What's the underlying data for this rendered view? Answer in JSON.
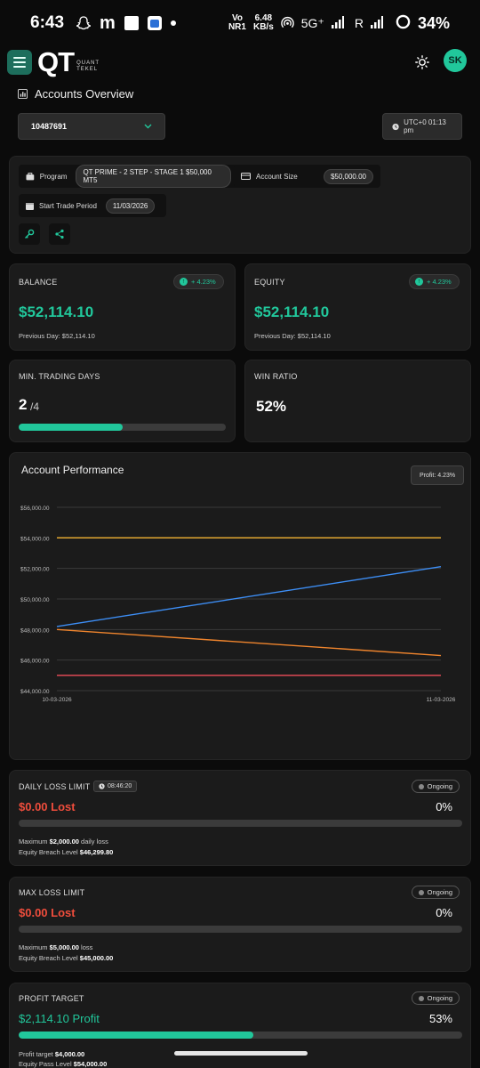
{
  "status_bar": {
    "time": "6:43",
    "net_top": "Vo",
    "net_bottom": "NR1",
    "speed_top": "6.48",
    "speed_bottom": "KB/s",
    "signal": "5G⁺",
    "r_label": "R",
    "battery": "34%"
  },
  "header": {
    "logo_main": "QT",
    "logo_sub_1": "QUANT",
    "logo_sub_2": "TEKEL",
    "avatar": "SK"
  },
  "page": {
    "title": "Accounts Overview"
  },
  "account": {
    "selected": "10487691",
    "utc": "UTC+0 01:13 pm"
  },
  "program": {
    "program_label": "Program",
    "program_value": "QT PRIME - 2 STEP - STAGE 1 $50,000 MT5",
    "size_label": "Account Size",
    "size_value": "$50,000.00",
    "start_label": "Start Trade Period",
    "start_value": "11/03/2026"
  },
  "balance": {
    "label": "BALANCE",
    "change": "+ 4.23%",
    "value": "$52,114.10",
    "previous": "Previous Day: $52,114.10"
  },
  "equity": {
    "label": "EQUITY",
    "change": "+ 4.23%",
    "value": "$52,114.10",
    "previous": "Previous Day: $52,114.10"
  },
  "min_days": {
    "label": "MIN. TRADING DAYS",
    "current": "2",
    "total": "/4",
    "progress": 0.5
  },
  "win_ratio": {
    "label": "WIN RATIO",
    "value": "52%"
  },
  "performance": {
    "title": "Account Performance",
    "profit_badge": "Profit: 4.23%"
  },
  "chart_data": {
    "type": "line",
    "x": [
      "10-03-2026",
      "11-03-2026"
    ],
    "yticks": [
      "$56,000.00",
      "$54,000.00",
      "$52,000.00",
      "$50,000.00",
      "$48,000.00",
      "$46,000.00",
      "$44,000.00"
    ],
    "ylim": [
      44000,
      56000
    ],
    "grid": true,
    "series": [
      {
        "color": "#f2b233",
        "values": [
          54000,
          54000
        ]
      },
      {
        "color": "#3d8ef5",
        "values": [
          48200,
          52114.1
        ]
      },
      {
        "color": "#f0852d",
        "values": [
          48000,
          46300
        ]
      },
      {
        "color": "#ef4d5a",
        "values": [
          45000,
          45000
        ]
      }
    ]
  },
  "daily_loss": {
    "label": "DAILY LOSS LIMIT",
    "timer": "08:46:20",
    "status": "Ongoing",
    "value": "$0.00 Lost",
    "pct": "0%",
    "progress": 0,
    "max_prefix": "Maximum ",
    "max_value": "$2,000.00",
    "max_suffix": " daily loss",
    "breach_label": "Equity Breach Level ",
    "breach_value": "$46,299.80"
  },
  "max_loss": {
    "label": "MAX LOSS LIMIT",
    "status": "Ongoing",
    "value": "$0.00 Lost",
    "pct": "0%",
    "progress": 0,
    "max_prefix": "Maximum ",
    "max_value": "$5,000.00",
    "max_suffix": " loss",
    "breach_label": "Equity Breach Level ",
    "breach_value": "$45,000.00"
  },
  "profit_target": {
    "label": "PROFIT TARGET",
    "status": "Ongoing",
    "value": "$2,114.10 Profit",
    "pct": "53%",
    "progress": 0.53,
    "target_label": "Profit target ",
    "target_value": "$4,000.00",
    "pass_label": "Equity Pass Level ",
    "pass_value": "$54,000.00"
  }
}
